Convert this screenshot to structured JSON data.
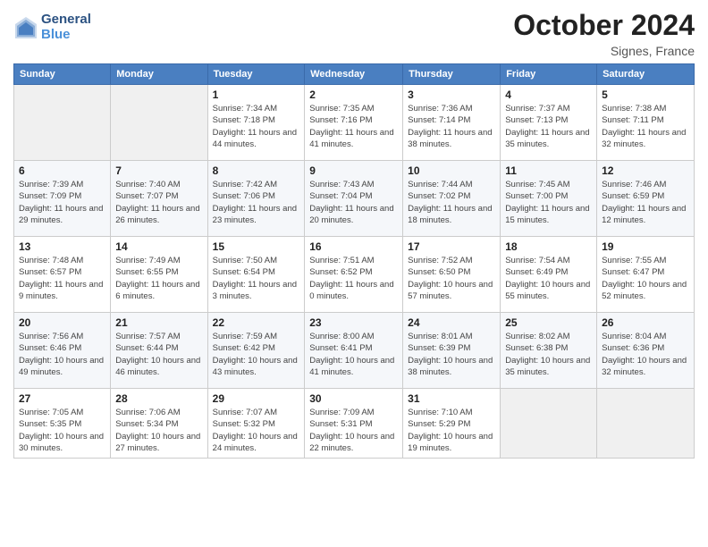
{
  "header": {
    "logo_line1": "General",
    "logo_line2": "Blue",
    "month": "October 2024",
    "location": "Signes, France"
  },
  "days_of_week": [
    "Sunday",
    "Monday",
    "Tuesday",
    "Wednesday",
    "Thursday",
    "Friday",
    "Saturday"
  ],
  "weeks": [
    [
      {
        "day": "",
        "info": ""
      },
      {
        "day": "",
        "info": ""
      },
      {
        "day": "1",
        "info": "Sunrise: 7:34 AM\nSunset: 7:18 PM\nDaylight: 11 hours and 44 minutes."
      },
      {
        "day": "2",
        "info": "Sunrise: 7:35 AM\nSunset: 7:16 PM\nDaylight: 11 hours and 41 minutes."
      },
      {
        "day": "3",
        "info": "Sunrise: 7:36 AM\nSunset: 7:14 PM\nDaylight: 11 hours and 38 minutes."
      },
      {
        "day": "4",
        "info": "Sunrise: 7:37 AM\nSunset: 7:13 PM\nDaylight: 11 hours and 35 minutes."
      },
      {
        "day": "5",
        "info": "Sunrise: 7:38 AM\nSunset: 7:11 PM\nDaylight: 11 hours and 32 minutes."
      }
    ],
    [
      {
        "day": "6",
        "info": "Sunrise: 7:39 AM\nSunset: 7:09 PM\nDaylight: 11 hours and 29 minutes."
      },
      {
        "day": "7",
        "info": "Sunrise: 7:40 AM\nSunset: 7:07 PM\nDaylight: 11 hours and 26 minutes."
      },
      {
        "day": "8",
        "info": "Sunrise: 7:42 AM\nSunset: 7:06 PM\nDaylight: 11 hours and 23 minutes."
      },
      {
        "day": "9",
        "info": "Sunrise: 7:43 AM\nSunset: 7:04 PM\nDaylight: 11 hours and 20 minutes."
      },
      {
        "day": "10",
        "info": "Sunrise: 7:44 AM\nSunset: 7:02 PM\nDaylight: 11 hours and 18 minutes."
      },
      {
        "day": "11",
        "info": "Sunrise: 7:45 AM\nSunset: 7:00 PM\nDaylight: 11 hours and 15 minutes."
      },
      {
        "day": "12",
        "info": "Sunrise: 7:46 AM\nSunset: 6:59 PM\nDaylight: 11 hours and 12 minutes."
      }
    ],
    [
      {
        "day": "13",
        "info": "Sunrise: 7:48 AM\nSunset: 6:57 PM\nDaylight: 11 hours and 9 minutes."
      },
      {
        "day": "14",
        "info": "Sunrise: 7:49 AM\nSunset: 6:55 PM\nDaylight: 11 hours and 6 minutes."
      },
      {
        "day": "15",
        "info": "Sunrise: 7:50 AM\nSunset: 6:54 PM\nDaylight: 11 hours and 3 minutes."
      },
      {
        "day": "16",
        "info": "Sunrise: 7:51 AM\nSunset: 6:52 PM\nDaylight: 11 hours and 0 minutes."
      },
      {
        "day": "17",
        "info": "Sunrise: 7:52 AM\nSunset: 6:50 PM\nDaylight: 10 hours and 57 minutes."
      },
      {
        "day": "18",
        "info": "Sunrise: 7:54 AM\nSunset: 6:49 PM\nDaylight: 10 hours and 55 minutes."
      },
      {
        "day": "19",
        "info": "Sunrise: 7:55 AM\nSunset: 6:47 PM\nDaylight: 10 hours and 52 minutes."
      }
    ],
    [
      {
        "day": "20",
        "info": "Sunrise: 7:56 AM\nSunset: 6:46 PM\nDaylight: 10 hours and 49 minutes."
      },
      {
        "day": "21",
        "info": "Sunrise: 7:57 AM\nSunset: 6:44 PM\nDaylight: 10 hours and 46 minutes."
      },
      {
        "day": "22",
        "info": "Sunrise: 7:59 AM\nSunset: 6:42 PM\nDaylight: 10 hours and 43 minutes."
      },
      {
        "day": "23",
        "info": "Sunrise: 8:00 AM\nSunset: 6:41 PM\nDaylight: 10 hours and 41 minutes."
      },
      {
        "day": "24",
        "info": "Sunrise: 8:01 AM\nSunset: 6:39 PM\nDaylight: 10 hours and 38 minutes."
      },
      {
        "day": "25",
        "info": "Sunrise: 8:02 AM\nSunset: 6:38 PM\nDaylight: 10 hours and 35 minutes."
      },
      {
        "day": "26",
        "info": "Sunrise: 8:04 AM\nSunset: 6:36 PM\nDaylight: 10 hours and 32 minutes."
      }
    ],
    [
      {
        "day": "27",
        "info": "Sunrise: 7:05 AM\nSunset: 5:35 PM\nDaylight: 10 hours and 30 minutes."
      },
      {
        "day": "28",
        "info": "Sunrise: 7:06 AM\nSunset: 5:34 PM\nDaylight: 10 hours and 27 minutes."
      },
      {
        "day": "29",
        "info": "Sunrise: 7:07 AM\nSunset: 5:32 PM\nDaylight: 10 hours and 24 minutes."
      },
      {
        "day": "30",
        "info": "Sunrise: 7:09 AM\nSunset: 5:31 PM\nDaylight: 10 hours and 22 minutes."
      },
      {
        "day": "31",
        "info": "Sunrise: 7:10 AM\nSunset: 5:29 PM\nDaylight: 10 hours and 19 minutes."
      },
      {
        "day": "",
        "info": ""
      },
      {
        "day": "",
        "info": ""
      }
    ]
  ]
}
